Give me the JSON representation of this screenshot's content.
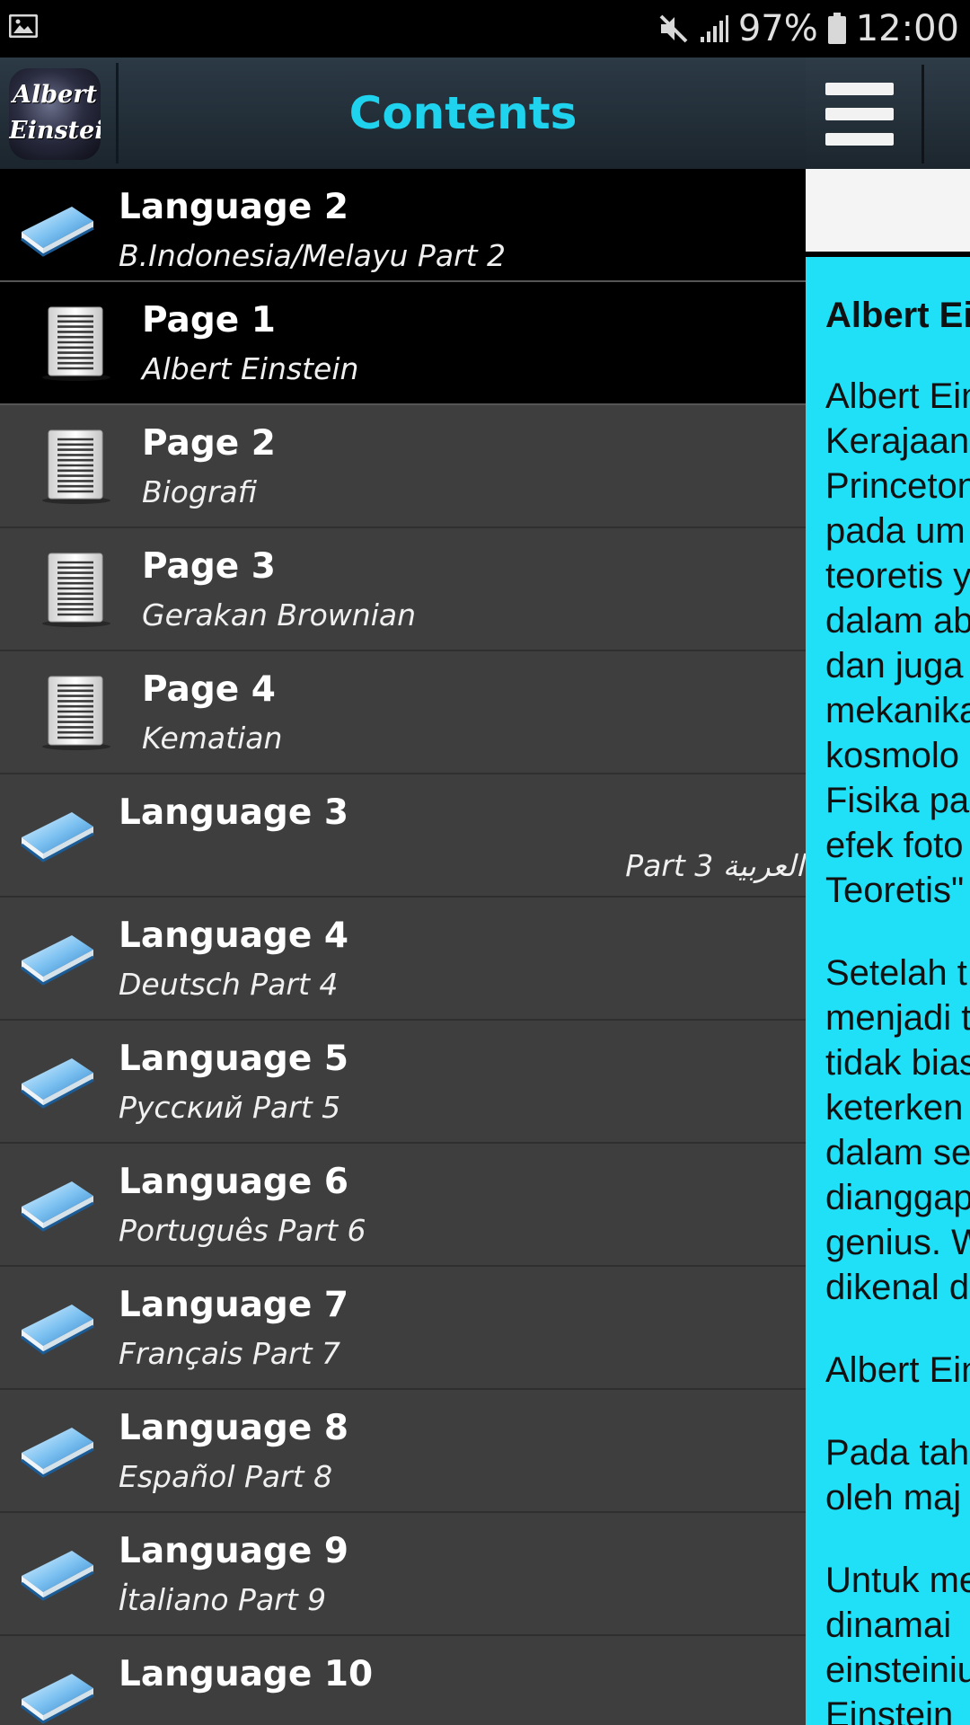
{
  "status_bar": {
    "battery": "97%",
    "time": "12:00",
    "icons": [
      "gallery-icon",
      "mute-icon",
      "signal-icon",
      "battery-icon"
    ]
  },
  "drawer": {
    "logo": {
      "line1": "Albert",
      "line2": "Einstein"
    },
    "title": "Contents",
    "title_color": "#1fd3ee",
    "items": [
      {
        "type": "language",
        "title": "Language 2",
        "subtitle": "B.Indonesia/Melayu Part 2",
        "icon": "book-icon"
      },
      {
        "type": "page",
        "title": "Page 1",
        "subtitle": "Albert Einstein",
        "icon": "page-icon",
        "selected": true
      },
      {
        "type": "page",
        "title": "Page 2",
        "subtitle": "Biografi",
        "icon": "page-icon"
      },
      {
        "type": "page",
        "title": "Page 3",
        "subtitle": "Gerakan Brownian",
        "icon": "page-icon"
      },
      {
        "type": "page",
        "title": "Page 4",
        "subtitle": "Kematian",
        "icon": "page-icon"
      },
      {
        "type": "language",
        "title": "Language 3",
        "subtitle": "العربية Part 3",
        "icon": "book-icon"
      },
      {
        "type": "language",
        "title": "Language 4",
        "subtitle": "Deutsch Part 4",
        "icon": "book-icon"
      },
      {
        "type": "language",
        "title": "Language 5",
        "subtitle": "Русский Part 5",
        "icon": "book-icon"
      },
      {
        "type": "language",
        "title": "Language 6",
        "subtitle": "Português Part 6",
        "icon": "book-icon"
      },
      {
        "type": "language",
        "title": "Language 7",
        "subtitle": "Français Part 7",
        "icon": "book-icon"
      },
      {
        "type": "language",
        "title": "Language 8",
        "subtitle": "Español Part 8",
        "icon": "book-icon"
      },
      {
        "type": "language",
        "title": "Language 9",
        "subtitle": "İtaliano Part 9",
        "icon": "book-icon"
      },
      {
        "type": "language",
        "title": "Language 10",
        "subtitle": "",
        "icon": "book-icon"
      }
    ]
  },
  "content": {
    "menu_icon": "hamburger-icon",
    "article_bg": "#1fe0f7",
    "heading": "Albert Ei",
    "paragraphs": [
      [
        "Albert Ein",
        "Kerajaan",
        "Princeton",
        "pada um",
        "teoretis y",
        "dalam ab",
        "dan juga",
        "mekanika",
        "kosmolo",
        "Fisika pa",
        "efek foto",
        "Teoretis\""
      ],
      [
        "Setelah t",
        "menjadi t",
        "tidak bias",
        "keterken",
        "dalam se",
        "dianggap",
        "genius. W",
        "dikenal d"
      ],
      [
        "Albert Ein"
      ],
      [
        "Pada tah",
        "oleh maj"
      ],
      [
        "Untuk me",
        "dinamai",
        "einsteiniu",
        "Einstein"
      ]
    ]
  }
}
